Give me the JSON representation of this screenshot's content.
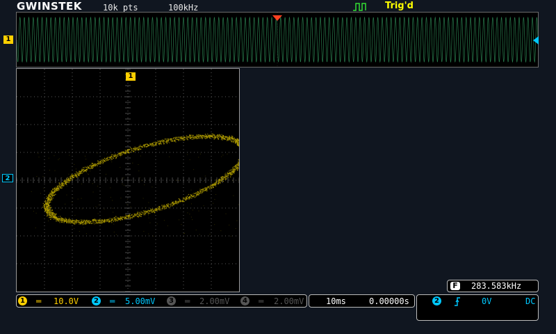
{
  "header": {
    "brand": "GWINSTEK",
    "points": "10k pts",
    "sample_rate": "100kHz",
    "trigger_status": "Trig'd"
  },
  "markers": {
    "ch1": "1",
    "ch2": "2"
  },
  "channels": [
    {
      "num": "1",
      "coupling_icon": "dc-coupling-icon",
      "scale": "10.0V",
      "color": "#ffd000",
      "active": true
    },
    {
      "num": "2",
      "coupling_icon": "dc-coupling-icon",
      "scale": "5.00mV",
      "color": "#00c8ff",
      "active": true
    },
    {
      "num": "3",
      "coupling_icon": "dc-coupling-icon",
      "scale": "2.00mV",
      "color": "#555555",
      "active": false
    },
    {
      "num": "4",
      "coupling_icon": "dc-coupling-icon",
      "scale": "2.00mV",
      "color": "#555555",
      "active": false
    }
  ],
  "timebase": {
    "scale": "10ms",
    "position": "0.00000s"
  },
  "frequency": {
    "label": "F",
    "value": "283.583kHz"
  },
  "trigger": {
    "source": "2",
    "slope_icon": "rising-edge-icon",
    "level": "0V",
    "coupling": "DC"
  },
  "colors": {
    "ch1": "#ffd000",
    "ch2": "#00c8ff",
    "overview_trace": "#2e8b57",
    "trigger_marker": "#ff4020"
  }
}
